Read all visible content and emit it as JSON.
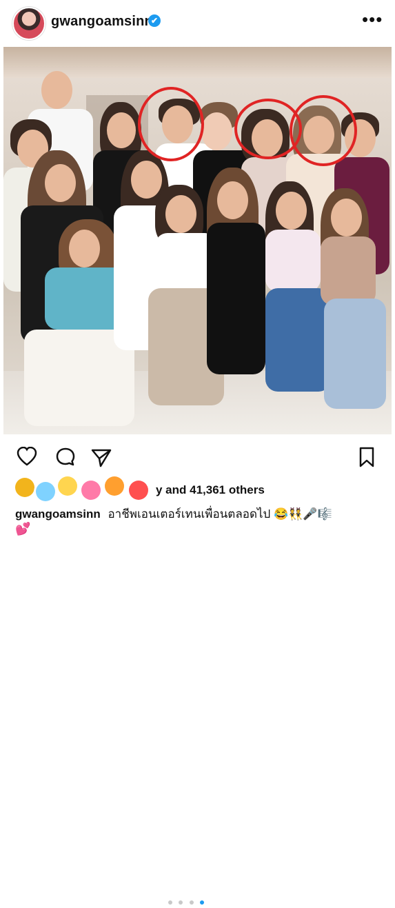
{
  "header": {
    "username": "gwangoamsinn",
    "verified_icon": "✔",
    "more_icon": "•••"
  },
  "post": {
    "carousel": {
      "total": 4,
      "active": 4
    },
    "likes_text": "y and 41,361 others",
    "caption_user": "gwangoamsinn",
    "caption_text": "อาชีพเอนเตอร์เทนเพื่อนตลอดไป 😂👯🎤🎼",
    "caption_extra": "💕"
  },
  "icons": {
    "like": "heart-icon",
    "comment": "comment-icon",
    "share": "send-icon",
    "save": "bookmark-icon"
  },
  "colors": {
    "annotation": "#e02424",
    "accent": "#1d9bf0"
  }
}
